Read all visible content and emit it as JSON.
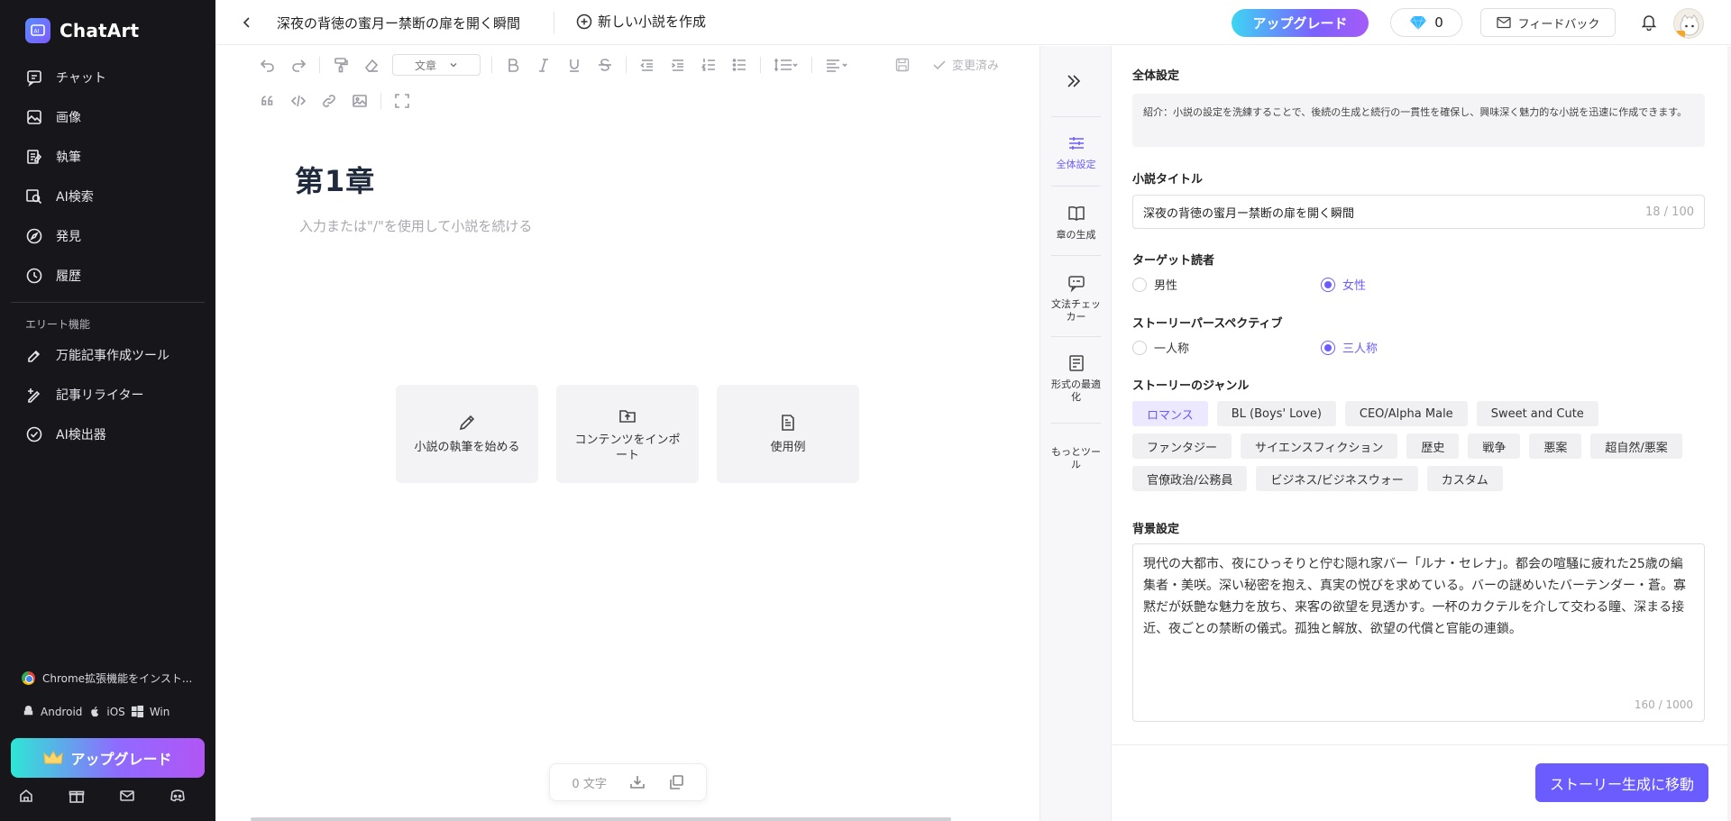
{
  "sidebar": {
    "brand": "ChatArt",
    "items": [
      {
        "label": "チャット",
        "icon": "chat-icon"
      },
      {
        "label": "画像",
        "icon": "image-icon"
      },
      {
        "label": "執筆",
        "icon": "writing-icon"
      },
      {
        "label": "AI検索",
        "icon": "ai-search-icon"
      },
      {
        "label": "発見",
        "icon": "discover-icon"
      },
      {
        "label": "履歴",
        "icon": "history-icon"
      }
    ],
    "section_label": "エリート機能",
    "elite_items": [
      {
        "label": "万能記事作成ツール",
        "icon": "article-tool-icon"
      },
      {
        "label": "記事リライター",
        "icon": "rewriter-icon"
      },
      {
        "label": "AI検出器",
        "icon": "ai-detector-icon"
      }
    ],
    "extension_label": "Chrome拡張機能をインスト...",
    "platforms": [
      "Android",
      "iOS",
      "Win"
    ],
    "upgrade_label": "アップグレード"
  },
  "topbar": {
    "doc_title": "深夜の背徳の蜜月ー禁断の扉を開く瞬間",
    "new_novel_label": "新しい小説を作成",
    "upgrade_label": "アップグレード",
    "gem_count": "0",
    "feedback_label": "フィードバック"
  },
  "editor": {
    "style_select": "文章",
    "saved_label": "変更済み",
    "chapter_title": "第1章",
    "placeholder": "入力または\"/\"を使用して小説を続ける",
    "cards": [
      {
        "label": "小説の執筆を始める",
        "icon": "pencil-icon"
      },
      {
        "label": "コンテンツをインポート",
        "icon": "import-icon"
      },
      {
        "label": "使用例",
        "icon": "example-icon"
      }
    ],
    "word_count": "0 文字"
  },
  "tabs": [
    {
      "label": "全体設定",
      "icon": "settings-sliders-icon",
      "active": true
    },
    {
      "label": "章の生成",
      "icon": "book-icon",
      "active": false
    },
    {
      "label": "文法チェッカー",
      "icon": "grammar-check-icon",
      "active": false
    },
    {
      "label": "形式の最適化",
      "icon": "format-icon",
      "active": false
    },
    {
      "label": "もっとツール",
      "icon": "",
      "active": false
    }
  ],
  "form": {
    "section_title": "全体設定",
    "intro": "紹介：小説の設定を洗練することで、後続の生成と続行の一貫性を確保し、興味深く魅力的な小説を迅速に作成できます。",
    "title_label": "小説タイトル",
    "title_value": "深夜の背徳の蜜月ー禁断の扉を開く瞬間",
    "title_count": "18 / 100",
    "audience_label": "ターゲット読者",
    "audience_options": [
      "男性",
      "女性"
    ],
    "audience_selected": 1,
    "perspective_label": "ストーリーパースペクティブ",
    "perspective_options": [
      "一人称",
      "三人称"
    ],
    "perspective_selected": 1,
    "genre_label": "ストーリーのジャンル",
    "genres": [
      "ロマンス",
      "BL (Boys' Love)",
      "CEO/Alpha Male",
      "Sweet and Cute",
      "ファンタジー",
      "サイエンスフィクション",
      "歴史",
      "戦争",
      "悪案",
      "超自然/悪案",
      "官僚政治/公務員",
      "ビジネス/ビジネスウォー",
      "カスタム"
    ],
    "genre_selected": 0,
    "background_label": "背景設定",
    "background_text": "現代の大都市、夜にひっそりと佇む隠れ家バー「ルナ・セレナ」。都会の喧騒に疲れた25歳の編集者・美咲。深い秘密を抱え、真実の悦びを求めている。バーの謎めいたバーテンダー・蒼。寡黙だが妖艶な魅力を放ち、来客の欲望を見透かす。一杯のカクテルを介して交わる瞳、深まる接近、夜ごとの禁断の儀式。孤独と解放、欲望の代償と官能の連鎖。",
    "background_count": "160 / 1000",
    "submit_label": "ストーリー生成に移動"
  },
  "colors": {
    "accent": "#6b5cff",
    "sidebar_bg": "#17171b"
  }
}
